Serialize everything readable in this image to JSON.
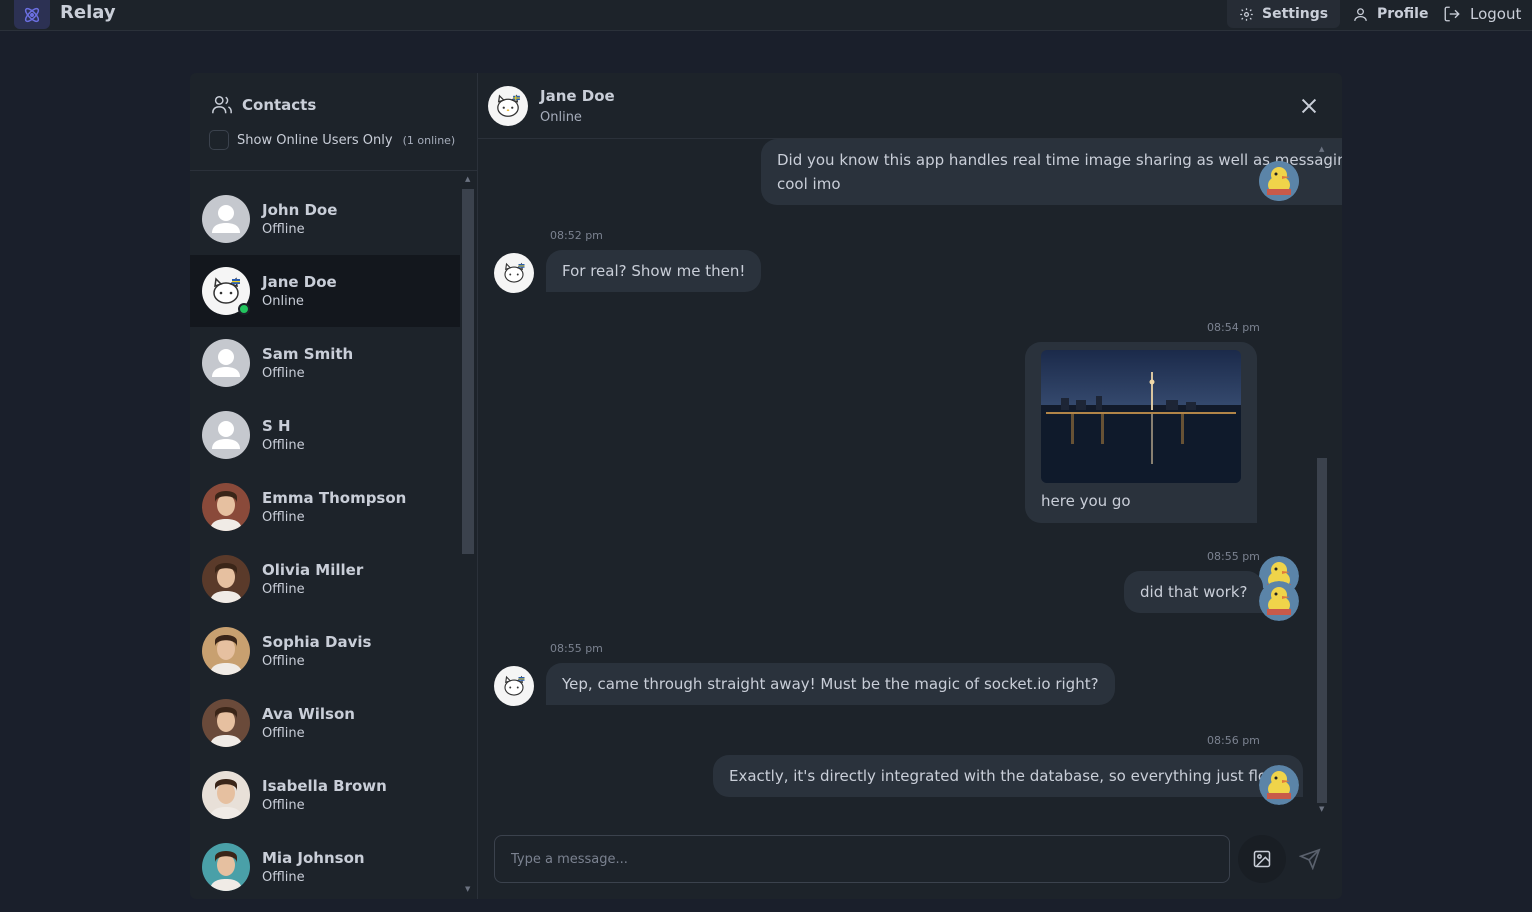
{
  "app": {
    "title": "Relay"
  },
  "nav": {
    "settings": "Settings",
    "profile": "Profile",
    "logout": "Logout"
  },
  "sidebar": {
    "title": "Contacts",
    "toggle_label": "Show Online Users Only",
    "online_count": "(1 online)",
    "contacts": [
      {
        "name": "John Doe",
        "status": "Offline",
        "avatar": "default-avatar"
      },
      {
        "name": "Jane Doe",
        "status": "Online",
        "avatar": "hello-kitty-avatar",
        "active": true,
        "online": true
      },
      {
        "name": "Sam Smith",
        "status": "Offline",
        "avatar": "default-avatar"
      },
      {
        "name": "S H",
        "status": "Offline",
        "avatar": "default-avatar"
      },
      {
        "name": "Emma Thompson",
        "status": "Offline",
        "avatar": "photo-avatar"
      },
      {
        "name": "Olivia Miller",
        "status": "Offline",
        "avatar": "photo-avatar"
      },
      {
        "name": "Sophia Davis",
        "status": "Offline",
        "avatar": "photo-avatar"
      },
      {
        "name": "Ava Wilson",
        "status": "Offline",
        "avatar": "photo-avatar"
      },
      {
        "name": "Isabella Brown",
        "status": "Offline",
        "avatar": "photo-avatar"
      },
      {
        "name": "Mia Johnson",
        "status": "Offline",
        "avatar": "photo-avatar"
      }
    ]
  },
  "chat": {
    "name": "Jane Doe",
    "status": "Online",
    "messages": [
      {
        "direction": "sent",
        "text": "Did you know this app handles real time image sharing as well as messaging? Pretty cool imo"
      },
      {
        "direction": "received",
        "time": "08:52 pm",
        "text": "For real? Show me then!"
      },
      {
        "direction": "sent",
        "time": "08:54 pm",
        "text": "here you go",
        "image": "city-skyline-night-photo"
      },
      {
        "direction": "sent",
        "time": "08:55 pm",
        "text": "did that work?"
      },
      {
        "direction": "received",
        "time": "08:55 pm",
        "text": "Yep, came through straight away! Must be the magic of socket.io right?"
      },
      {
        "direction": "sent",
        "time": "08:56 pm",
        "text": "Exactly, it's directly integrated with the database, so everything just flows"
      }
    ],
    "input_placeholder": "Type a message..."
  },
  "colors": {
    "background": "#1a1f2b",
    "panel": "#1d232a",
    "bubble": "#2a323c",
    "online": "#22c55e",
    "accent": "#6b6fe0"
  }
}
